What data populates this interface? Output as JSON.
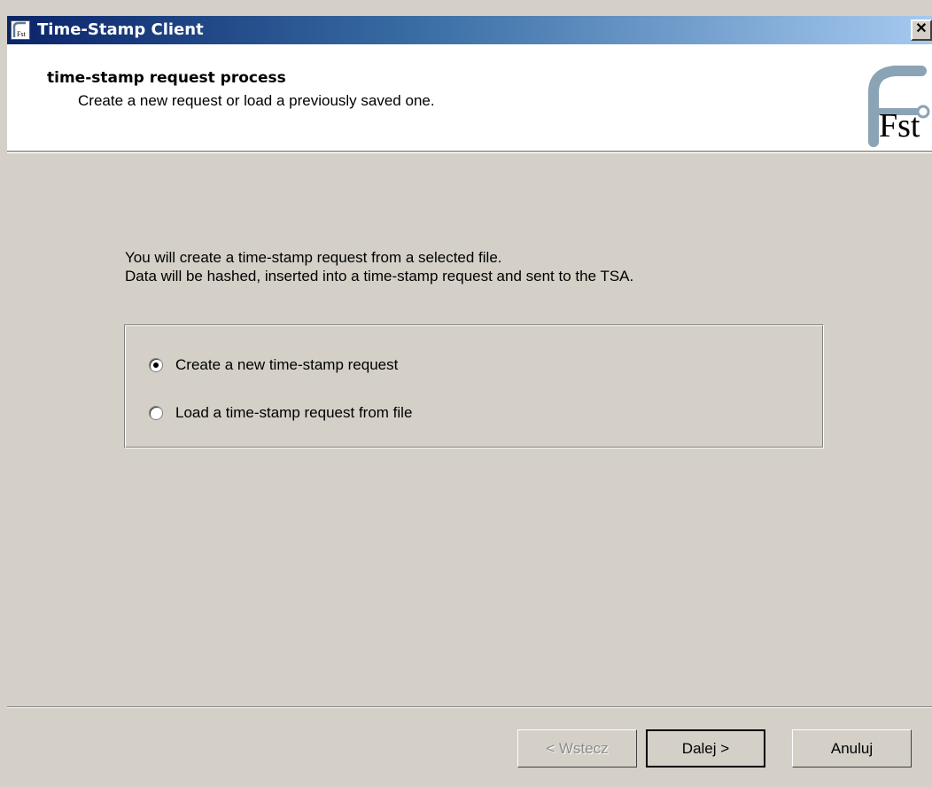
{
  "window": {
    "title": "Time-Stamp Client",
    "app_icon": "fst-app-icon",
    "close_icon": "close-icon",
    "close_label": "✕"
  },
  "header": {
    "title": "time-stamp request process",
    "subtitle": "Create a new request or load a previously saved one.",
    "logo_text": "Fst"
  },
  "content": {
    "line1": "You will create a time-stamp request from a selected file.",
    "line2": "Data will be hashed, inserted into a time-stamp request and sent to the TSA."
  },
  "options": [
    {
      "label": "Create a new time-stamp request",
      "selected": true
    },
    {
      "label": "Load a time-stamp request from file",
      "selected": false
    }
  ],
  "buttons": {
    "back": "< Wstecz",
    "next": "Dalej >",
    "cancel": "Anuluj"
  },
  "colors": {
    "title_gradient_start": "#0a246a",
    "title_gradient_end": "#a6caf0",
    "dialog_bg": "#d4d0c8",
    "header_bg": "#ffffff",
    "logo_steel": "#8aa3b5"
  }
}
